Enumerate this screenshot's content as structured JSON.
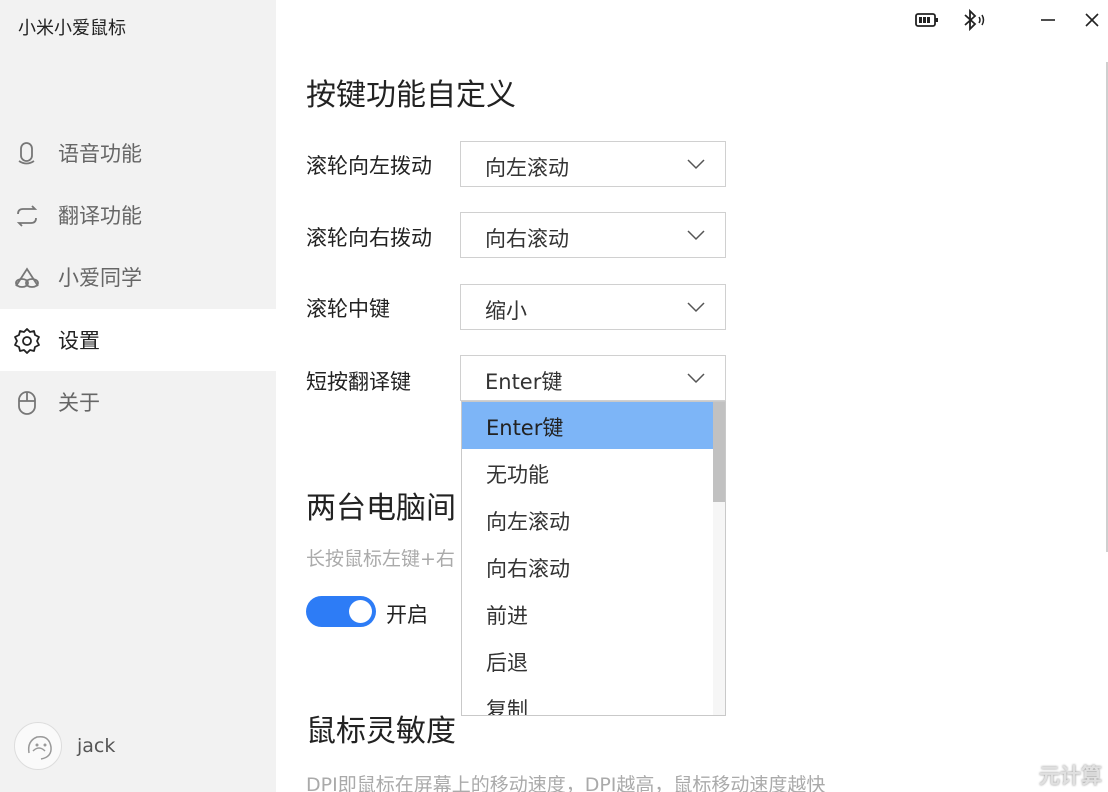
{
  "app": {
    "title": "小米小爱鼠标"
  },
  "sidebar": {
    "items": [
      {
        "label": "语音功能",
        "icon": "microphone-icon"
      },
      {
        "label": "翻译功能",
        "icon": "translate-icon"
      },
      {
        "label": "小爱同学",
        "icon": "xiaoai-icon"
      },
      {
        "label": "设置",
        "icon": "gear-icon",
        "active": true
      },
      {
        "label": "关于",
        "icon": "mouse-icon"
      }
    ],
    "user": {
      "name": "jack"
    }
  },
  "main": {
    "section1": {
      "title": "按键功能自定义",
      "rows": [
        {
          "label": "滚轮向左拨动",
          "value": "向左滚动"
        },
        {
          "label": "滚轮向右拨动",
          "value": "向右滚动"
        },
        {
          "label": "滚轮中键",
          "value": "缩小"
        },
        {
          "label": "短按翻译键",
          "value": "Enter键"
        }
      ]
    },
    "section2": {
      "title": "两台电脑间",
      "desc": "长按鼠标左键+右",
      "toggle_label": "开启",
      "toggle_on": true
    },
    "section3": {
      "title": "鼠标灵敏度",
      "desc": "DPI即鼠标在屏幕上的移动速度，DPI越高，鼠标移动速度越快"
    }
  },
  "dropdown": {
    "options": [
      "Enter键",
      "无功能",
      "向左滚动",
      "向右滚动",
      "前进",
      "后退",
      "复制"
    ],
    "selected": "Enter键"
  },
  "watermark": "元计算",
  "colors": {
    "accent": "#2d7cf6",
    "selected_option": "#7db5f7",
    "sidebar_bg": "#f2f2f2"
  }
}
